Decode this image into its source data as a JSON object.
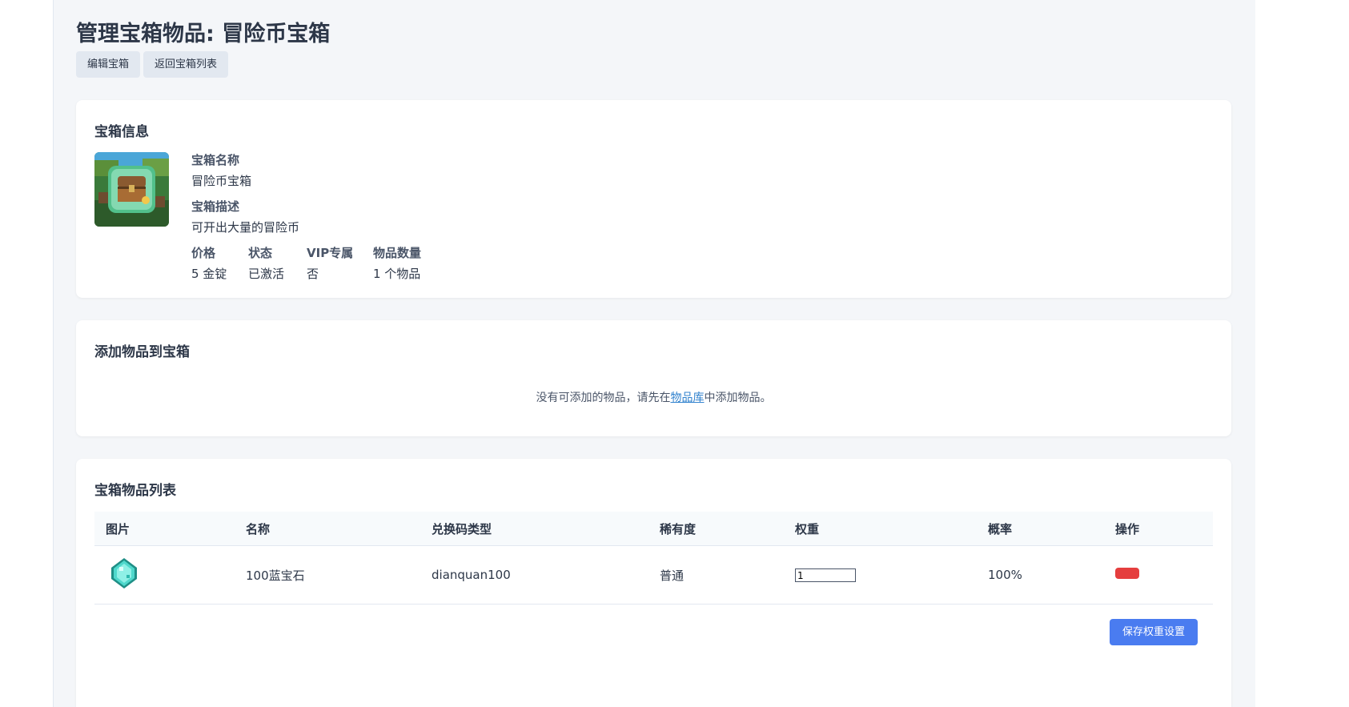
{
  "page": {
    "title": "管理宝箱物品: 冒险币宝箱",
    "buttons": {
      "edit": "编辑宝箱",
      "back": "返回宝箱列表"
    }
  },
  "chest_info": {
    "heading": "宝箱信息",
    "name_label": "宝箱名称",
    "name_value": "冒险币宝箱",
    "desc_label": "宝箱描述",
    "desc_value": "可开出大量的冒险币",
    "price_label": "价格",
    "price_value": "5 金锭",
    "status_label": "状态",
    "status_value": "已激活",
    "vip_label": "VIP专属",
    "vip_value": "否",
    "count_label": "物品数量",
    "count_value": "1 个物品"
  },
  "add_items": {
    "heading": "添加物品到宝箱",
    "msg_before": "没有可添加的物品，请先在",
    "msg_link": "物品库",
    "msg_after": "中添加物品。"
  },
  "item_list": {
    "heading": "宝箱物品列表",
    "columns": [
      "图片",
      "名称",
      "兑换码类型",
      "稀有度",
      "权重",
      "概率",
      "操作"
    ],
    "rows": [
      {
        "name": "100蓝宝石",
        "code_type": "dianquan100",
        "rarity": "普通",
        "weight": "1",
        "probability": "100%"
      }
    ],
    "save_button": "保存权重设置"
  },
  "colors": {
    "accent": "#4a7cf0",
    "danger": "#e53e3e",
    "link": "#3182ce",
    "background": "#f4f6f9"
  },
  "icons": {
    "chest_image": "treasure-chest-icon",
    "item_image": "diamond-icon",
    "delete": "delete-button"
  }
}
